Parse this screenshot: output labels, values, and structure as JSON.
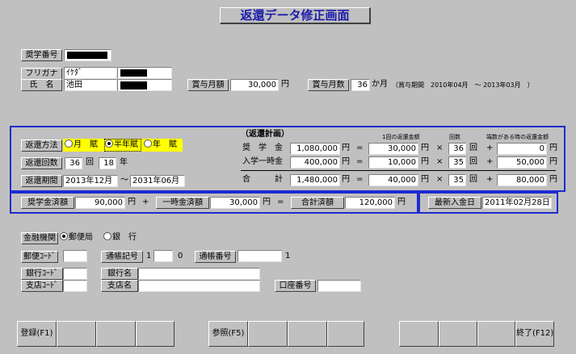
{
  "title": "返還データ修正画面",
  "student": {
    "number_label": "奨学番号",
    "furigana_label": "フリガナ",
    "furigana_value": "ｲｹﾀﾞ",
    "name_label": "氏　名",
    "name_value": "池田"
  },
  "bonus": {
    "amount_label": "賞与月額",
    "amount_value": "30,000",
    "yen": "円",
    "count_label": "賞与月数",
    "count_value": "36",
    "count_unit": "か月",
    "period_text": "（賞与期間　2010年04月　～ 2013年03月　）"
  },
  "repayment": {
    "method_label": "返還方法",
    "method_options": [
      "月　賦",
      "半年賦",
      "年　賦"
    ],
    "method_selected_index": 1,
    "count_label": "返還回数",
    "count_value": "36",
    "count_unit": "回",
    "years_value": "18",
    "years_unit": "年",
    "period_label": "返還期間",
    "period_start": "2013年12月",
    "period_sep": "～",
    "period_end": "2031年06月"
  },
  "plan": {
    "heading": "（返還計画）",
    "col_amount": "1回の返還金額",
    "col_count": "回数",
    "col_fraction": "端数がある時の返還金額",
    "rows": [
      {
        "label": "奨　学　金",
        "total": "1,080,000",
        "yen1": "円",
        "eq": "=",
        "per": "30,000",
        "yen2": "円",
        "times": "×",
        "count": "36",
        "kai": "回",
        "plus": "+",
        "frac": "0",
        "yen3": "円"
      },
      {
        "label": "入学一時金",
        "total": "400,000",
        "yen1": "円",
        "eq": "=",
        "per": "10,000",
        "yen2": "円",
        "times": "×",
        "count": "35",
        "kai": "回",
        "plus": "+",
        "frac": "50,000",
        "yen3": "円"
      },
      {
        "label": "合　　　計",
        "total": "1,480,000",
        "yen1": "円",
        "eq": "=",
        "per": "40,000",
        "yen2": "円",
        "times": "×",
        "count": "35",
        "kai": "回",
        "plus": "+",
        "frac": "80,000",
        "yen3": "円"
      }
    ]
  },
  "paid": {
    "scholarship_label": "奨学金済額",
    "scholarship_value": "90,000",
    "yen": "円",
    "plus": "+",
    "lump_label": "一時金済額",
    "lump_value": "30,000",
    "eq": "=",
    "total_label": "合計済額",
    "total_value": "120,000",
    "latest_label": "最新入金日",
    "latest_value": "2011年02月28日"
  },
  "bank": {
    "institution_label": "金融機関",
    "institution_options": [
      "郵便局",
      "銀　行"
    ],
    "institution_selected_index": 0,
    "postal_code_label": "郵便ｺｰﾄﾞ",
    "passbook_symbol_label": "通帳記号",
    "passbook_symbol_value1": "1",
    "passbook_symbol_value2": "0",
    "passbook_number_label": "通帳番号",
    "passbook_number_value": "1",
    "bank_code_label": "銀行ｺｰﾄﾞ",
    "bank_name_label": "銀行名",
    "branch_code_label": "支店ｺｰﾄﾞ",
    "branch_name_label": "支店名",
    "account_number_label": "口座番号"
  },
  "fkeys": {
    "f1": "登録(F1)",
    "f5": "参照(F5)",
    "f12": "終了(F12)"
  },
  "colors": {
    "background": "#c0c0c0",
    "panel_border": "#1f2bd0",
    "title_text": "#1c1caa",
    "highlight": "#ffff00"
  }
}
